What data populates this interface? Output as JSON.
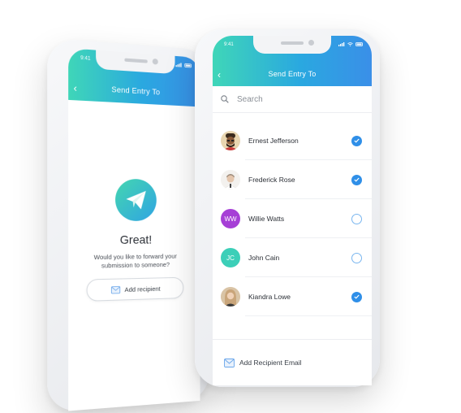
{
  "colors": {
    "header_start": "#3fd6b8",
    "header_end": "#3a8fe8",
    "check": "#2f8fe8",
    "check_off_border": "#7ab6ef"
  },
  "back_phone": {
    "status_time": "9:41",
    "header_title": "Send Entry To",
    "back_icon": "chevron-left-icon",
    "hero_icon": "paper-plane-icon",
    "great_text": "Great!",
    "prompt_line1": "Would you like to forward your",
    "prompt_line2": "submission to someone?",
    "add_button_label": "Add recipient",
    "add_button_icon": "mail-icon"
  },
  "front_phone": {
    "status_time": "9:41",
    "header_title": "Send Entry To",
    "search_placeholder": "Search",
    "contacts": [
      {
        "name": "Ernest Jefferson",
        "initials": "",
        "selected": true,
        "avatar_color": "#6b4a2b"
      },
      {
        "name": "Frederick Rose",
        "initials": "",
        "selected": true,
        "avatar_color": "#d9c7b8"
      },
      {
        "name": "Willie Watts",
        "initials": "WW",
        "selected": false,
        "avatar_color": "#a63fd6"
      },
      {
        "name": "John Cain",
        "initials": "JC",
        "selected": false,
        "avatar_color": "#3ccfb8"
      },
      {
        "name": "Kiandra Lowe",
        "initials": "",
        "selected": true,
        "avatar_color": "#b89a7a"
      }
    ],
    "add_email_label": "Add Recipient Email",
    "add_email_icon": "mail-icon"
  }
}
